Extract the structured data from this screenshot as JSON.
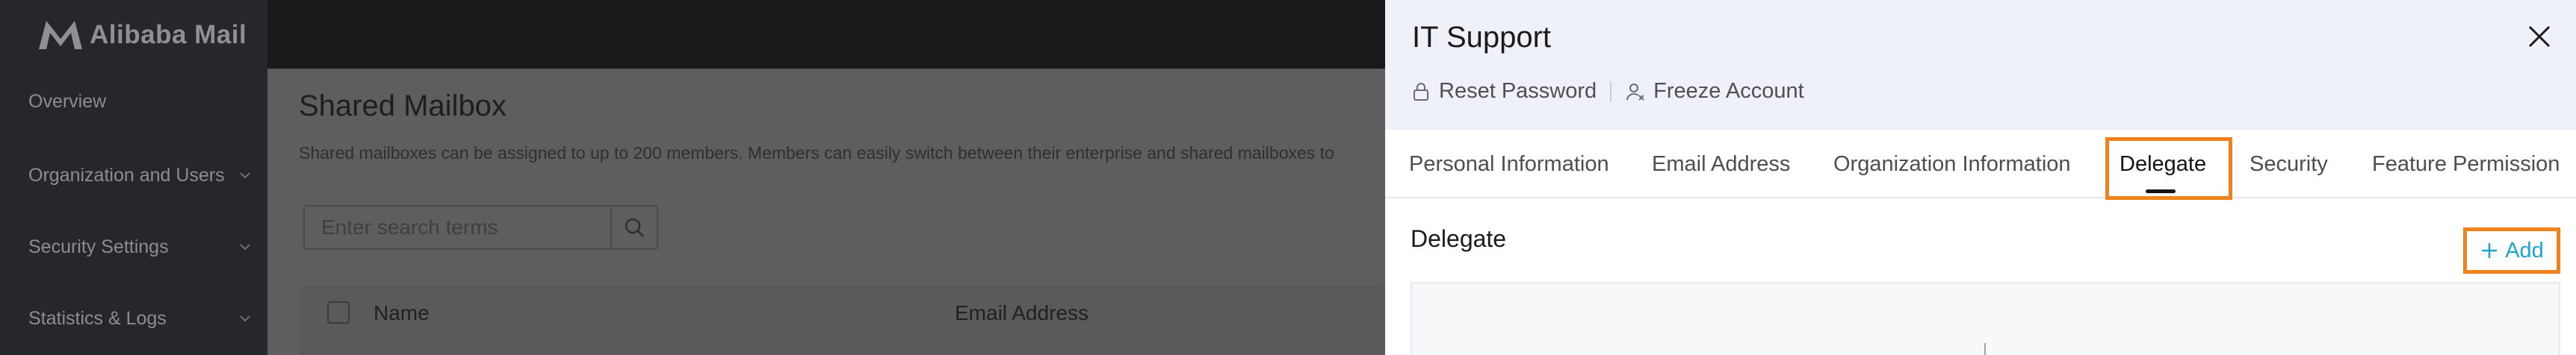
{
  "app": {
    "name": "Alibaba Mail"
  },
  "sidebar": {
    "items": [
      {
        "label": "Overview",
        "has_chevron": false
      },
      {
        "label": "Organization and Users",
        "has_chevron": true
      },
      {
        "label": "Security Settings",
        "has_chevron": true
      },
      {
        "label": "Statistics & Logs",
        "has_chevron": true
      }
    ]
  },
  "main": {
    "title": "Shared Mailbox",
    "description": "Shared mailboxes can be assigned to up to 200 members. Members can easily switch between their enterprise and shared mailboxes to",
    "search": {
      "placeholder": "Enter search terms",
      "value": ""
    },
    "table": {
      "columns": [
        "Name",
        "Email Address"
      ]
    }
  },
  "drawer": {
    "title": "IT Support",
    "actions": [
      {
        "label": "Reset Password",
        "icon": "lock-icon"
      },
      {
        "label": "Freeze Account",
        "icon": "user-freeze-icon"
      }
    ],
    "tabs": [
      {
        "label": "Personal Information",
        "active": false
      },
      {
        "label": "Email Address",
        "active": false
      },
      {
        "label": "Organization Information",
        "active": false
      },
      {
        "label": "Delegate",
        "active": true
      },
      {
        "label": "Security",
        "active": false
      },
      {
        "label": "Feature Permission",
        "active": false
      }
    ],
    "section_title": "Delegate",
    "add_label": "Add"
  },
  "colors": {
    "accent": "#1aa4d0",
    "highlight": "#f0821e",
    "sidebar_bg": "#26272b",
    "drawer_header_bg": "#eef1f8"
  }
}
